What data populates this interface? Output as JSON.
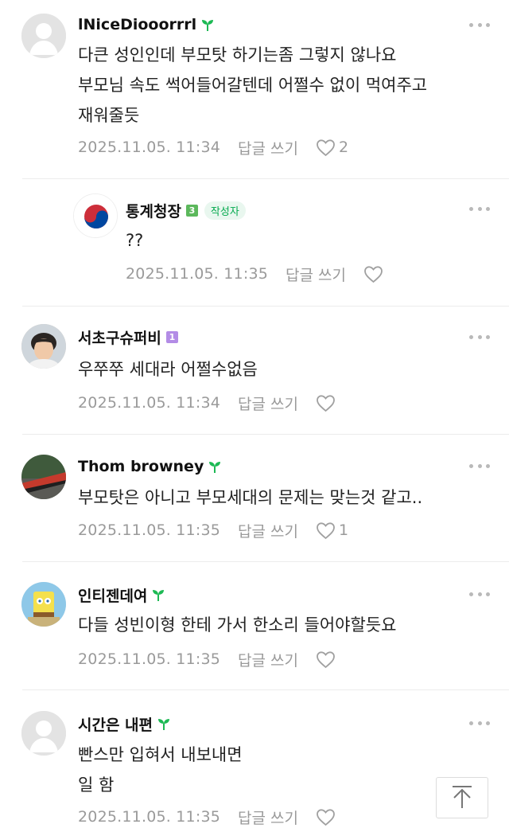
{
  "comments": [
    {
      "author": "lNiceDiooorrrl",
      "text": "다큰 성인인데 부모탓 하기는좀 그렇지 않나요\n부모님 속도 썩어들어갈텐데 어쩔수 없이 먹여주고\n재워줄듯",
      "date": "2025.11.05. 11:34",
      "reply_label": "답글 쓰기",
      "likes": "2"
    },
    {
      "author": "통계청장",
      "level": "3",
      "author_badge": "작성자",
      "text": "??",
      "date": "2025.11.05. 11:35",
      "reply_label": "답글 쓰기",
      "likes": ""
    },
    {
      "author": "서초구슈퍼비",
      "level": "1",
      "text": "우쭈쭈 세대라 어쩔수없음",
      "date": "2025.11.05. 11:34",
      "reply_label": "답글 쓰기",
      "likes": ""
    },
    {
      "author": "Thom browney",
      "text": "부모탓은 아니고 부모세대의 문제는 맞는것 같고..",
      "date": "2025.11.05. 11:35",
      "reply_label": "답글 쓰기",
      "likes": "1"
    },
    {
      "author": "인티젠데여",
      "text": "다들 성빈이형 한테 가서 한소리 들어야할듯요",
      "date": "2025.11.05. 11:35",
      "reply_label": "답글 쓰기",
      "likes": ""
    },
    {
      "author": "시간은 내편",
      "text": "빤스만 입혀서 내보내면\n일 함",
      "date": "2025.11.05. 11:35",
      "reply_label": "답글 쓰기",
      "likes": ""
    }
  ],
  "colors": {
    "sprout_green": "#1db954",
    "author_badge_green": "#03a94d",
    "level3_badge": "#5cb85c",
    "level1_badge": "#b38ce6",
    "meta_gray": "#9a9a9a"
  },
  "icons": {
    "more": "more-dots-icon",
    "like": "heart-icon",
    "sprout": "sprout-icon",
    "scroll_top": "arrow-up-icon"
  }
}
